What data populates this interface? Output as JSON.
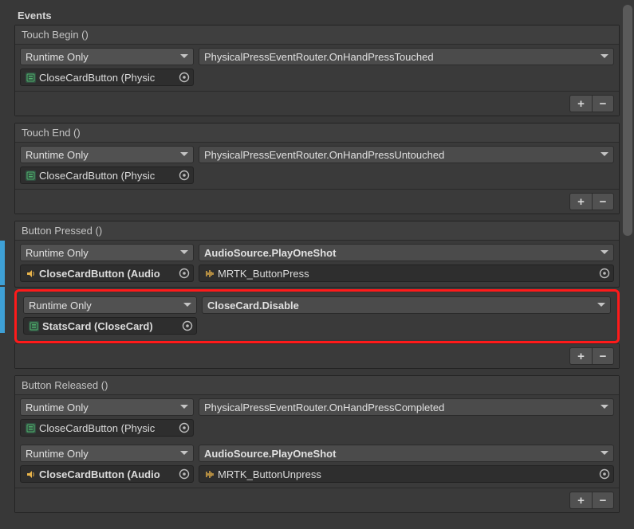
{
  "title": "Events",
  "touch_begin": {
    "header": "Touch Begin ()",
    "mode": "Runtime Only",
    "func": "PhysicalPressEventRouter.OnHandPressTouched",
    "obj": "CloseCardButton (Physic"
  },
  "touch_end": {
    "header": "Touch End ()",
    "mode": "Runtime Only",
    "func": "PhysicalPressEventRouter.OnHandPressUntouched",
    "obj": "CloseCardButton (Physic"
  },
  "button_pressed": {
    "header": "Button Pressed ()",
    "r1": {
      "mode": "Runtime Only",
      "func": "AudioSource.PlayOneShot",
      "obj": "CloseCardButton (Audio",
      "arg": "MRTK_ButtonPress"
    },
    "r2": {
      "mode": "Runtime Only",
      "func": "CloseCard.Disable",
      "obj": "StatsCard (CloseCard)"
    }
  },
  "button_released": {
    "header": "Button Released ()",
    "r1": {
      "mode": "Runtime Only",
      "func": "PhysicalPressEventRouter.OnHandPressCompleted",
      "obj": "CloseCardButton (Physic"
    },
    "r2": {
      "mode": "Runtime Only",
      "func": "AudioSource.PlayOneShot",
      "obj": "CloseCardButton (Audio",
      "arg": "MRTK_ButtonUnpress"
    }
  },
  "plus": "+",
  "minus": "−"
}
